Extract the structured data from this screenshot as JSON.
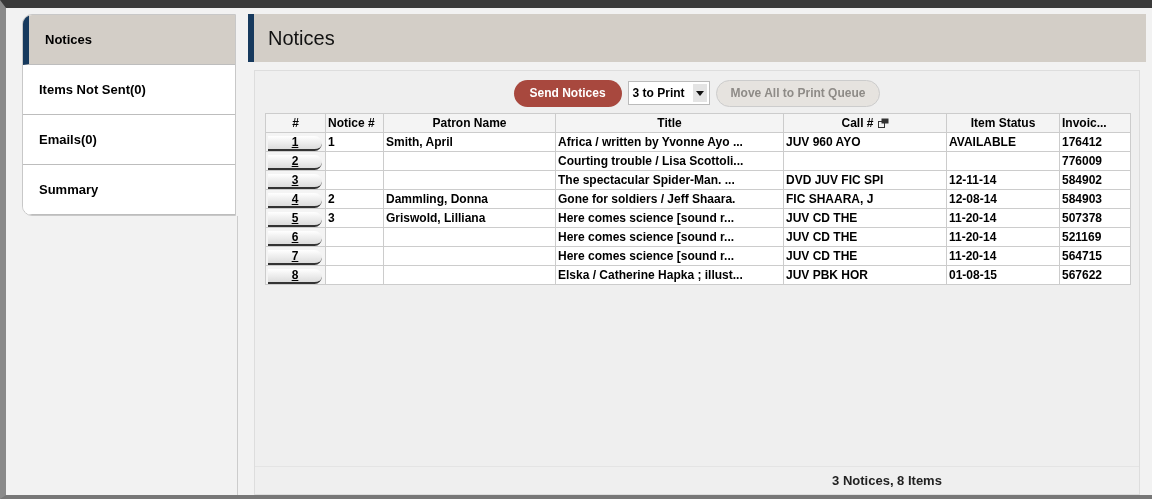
{
  "sidebar": {
    "items": [
      {
        "label": "Notices",
        "selected": true
      },
      {
        "label": "Items Not Sent(0)",
        "selected": false
      },
      {
        "label": "Emails(0)",
        "selected": false
      },
      {
        "label": "Summary",
        "selected": false
      }
    ]
  },
  "header": {
    "title": "Notices"
  },
  "toolbar": {
    "send_button": {
      "label": "Send Notices"
    },
    "print_select": {
      "value": "3 to Print"
    },
    "move_button": {
      "label": "Move All to Print Queue",
      "disabled": true
    }
  },
  "table": {
    "columns": [
      "#",
      "Notice #",
      "Patron Name",
      "Title",
      "Call #",
      "Item Status",
      "Invoic..."
    ],
    "rows": [
      {
        "index": "1",
        "notice": "1",
        "patron": "Smith, April",
        "title": "Africa / written by Yvonne Ayo ...",
        "call": "JUV 960 AYO",
        "status": "AVAILABLE",
        "invoice": "176412"
      },
      {
        "index": "2",
        "notice": "",
        "patron": "",
        "title": "Courting trouble / Lisa Scottoli...",
        "call": "",
        "status": "",
        "invoice": "776009"
      },
      {
        "index": "3",
        "notice": "",
        "patron": "",
        "title": "The spectacular Spider-Man. ...",
        "call": "DVD JUV FIC SPI",
        "status": "12-11-14",
        "invoice": "584902"
      },
      {
        "index": "4",
        "notice": "2",
        "patron": "Dammling, Donna",
        "title": "Gone for soldiers / Jeff Shaara.",
        "call": "FIC SHAARA, J",
        "status": "12-08-14",
        "invoice": "584903"
      },
      {
        "index": "5",
        "notice": "3",
        "patron": "Griswold, Lilliana",
        "title": "Here comes science [sound r...",
        "call": "JUV CD THE",
        "status": "11-20-14",
        "invoice": "507378"
      },
      {
        "index": "6",
        "notice": "",
        "patron": "",
        "title": "Here comes science [sound r...",
        "call": "JUV CD THE",
        "status": "11-20-14",
        "invoice": "521169"
      },
      {
        "index": "7",
        "notice": "",
        "patron": "",
        "title": "Here comes science [sound r...",
        "call": "JUV CD THE",
        "status": "11-20-14",
        "invoice": "564715"
      },
      {
        "index": "8",
        "notice": "",
        "patron": "",
        "title": "Elska / Catherine Hapka ; illust...",
        "call": "JUV PBK HOR",
        "status": "01-08-15",
        "invoice": "567622"
      }
    ]
  },
  "status_bar": {
    "text": "3 Notices, 8 Items"
  }
}
